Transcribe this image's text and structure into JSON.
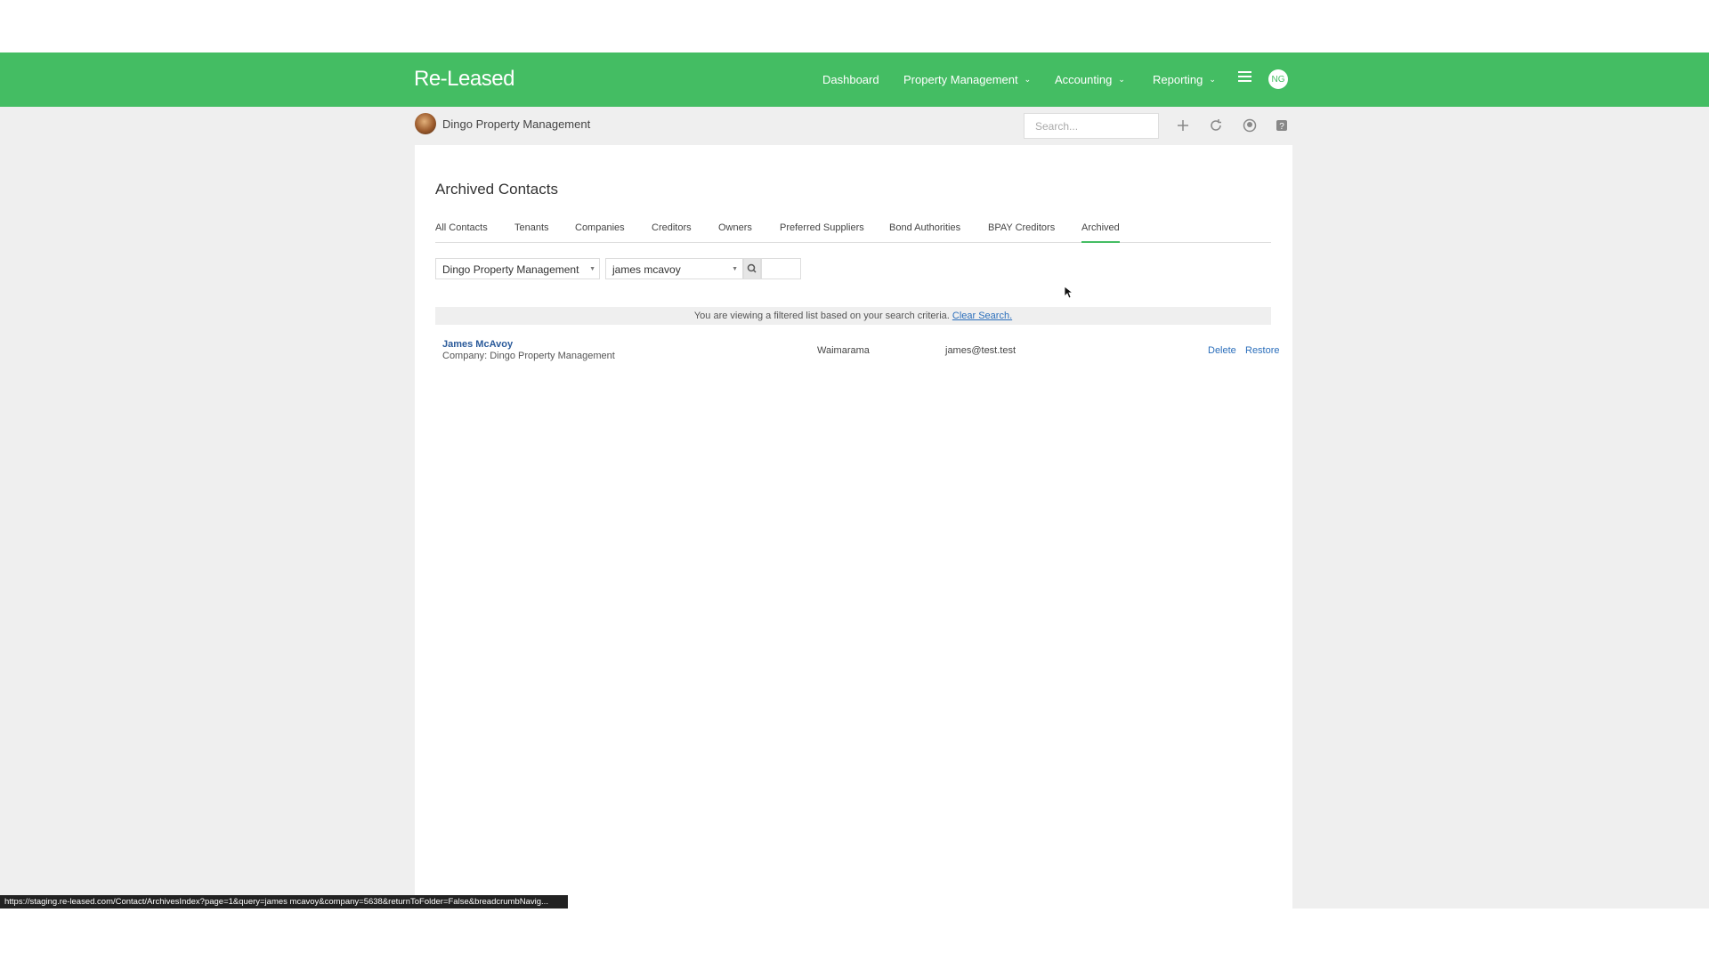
{
  "colors": {
    "brand_green": "#44bd63",
    "link_blue": "#2a6ebb"
  },
  "navbar": {
    "logo": "Re-Leased",
    "items": [
      {
        "label": "Dashboard"
      },
      {
        "label": "Property Management",
        "dropdown": true
      },
      {
        "label": "Accounting",
        "dropdown": true
      },
      {
        "label": "Reporting",
        "dropdown": true
      }
    ],
    "menu_icon": "hamburger-menu-icon",
    "user_initials": "NG"
  },
  "subbar": {
    "org_name": "Dingo Property Management",
    "search_placeholder": "Search...",
    "tools": [
      "plus-icon",
      "refresh-icon",
      "support-icon",
      "help-icon"
    ]
  },
  "page": {
    "title": "Archived Contacts",
    "tabs": [
      {
        "label": "All Contacts"
      },
      {
        "label": "Tenants"
      },
      {
        "label": "Companies"
      },
      {
        "label": "Creditors"
      },
      {
        "label": "Owners"
      },
      {
        "label": "Preferred Suppliers"
      },
      {
        "label": "Bond Authorities"
      },
      {
        "label": "BPAY Creditors"
      },
      {
        "label": "Archived",
        "active": true
      }
    ],
    "filters": {
      "company": "Dingo Property Management",
      "query": "james mcavoy"
    },
    "notice": {
      "text": "You are viewing a filtered list based on your search criteria.",
      "link": "Clear Search."
    },
    "results": [
      {
        "name": "James McAvoy",
        "company": "Company: Dingo Property Management",
        "location": "Waimarama",
        "email": "james@test.test",
        "actions": [
          "Delete",
          "Restore"
        ]
      }
    ]
  },
  "status_bar": {
    "url": "https://staging.re-leased.com/Contact/ArchivesIndex?page=1&query=james mcavoy&company=5638&returnToFolder=False&breadcrumbNavig..."
  }
}
